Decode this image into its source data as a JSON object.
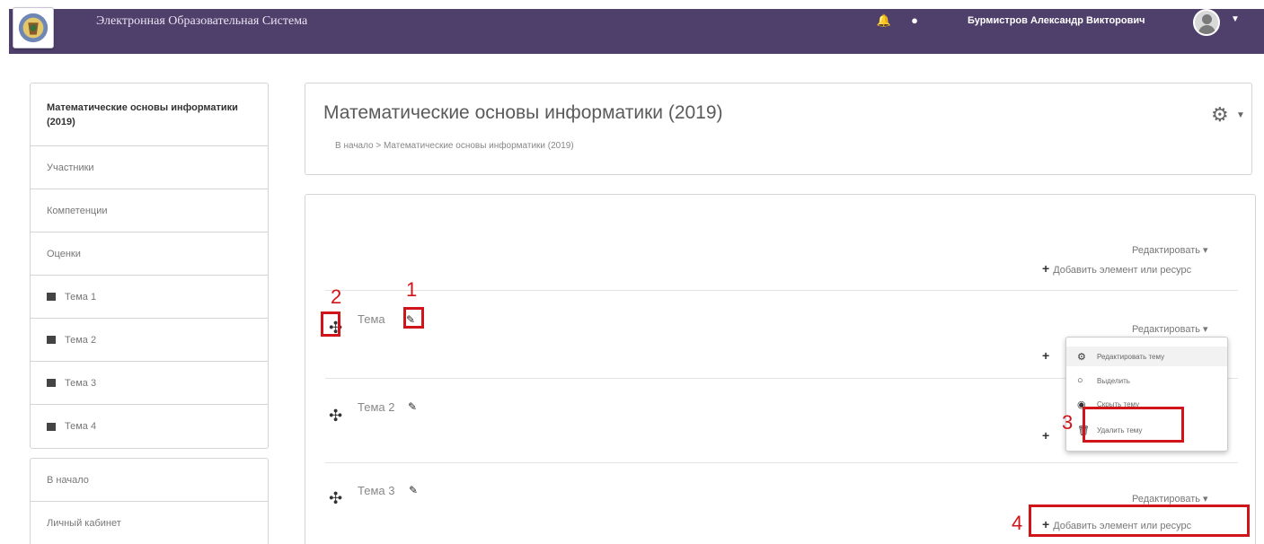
{
  "header": {
    "site_name": "Электронная Образовательная Система",
    "user_name": "Бурмистров Александр Викторович",
    "icons": [
      "bell-icon",
      "chat-icon",
      "avatar-icon",
      "caret-down-icon"
    ]
  },
  "sidebar": {
    "course": "Математические основы информатики (2019)",
    "items": [
      "Участники",
      "Компетенции",
      "Оценки",
      "Тема 1",
      "Тема 2",
      "Тема 3",
      "Тема 4"
    ],
    "nav": [
      "В начало",
      "Личный кабинет"
    ]
  },
  "course_header": {
    "title": "Математические основы информатики (2019)",
    "breadcrumb": "В начало  >  Математические основы информатики (2019)"
  },
  "content": {
    "edit_label": "Редактировать",
    "add_label": "Добавить элемент или ресурс",
    "sections": [
      {
        "title": "Тема"
      },
      {
        "title": "Тема 2"
      },
      {
        "title": "Тема 3"
      }
    ],
    "menu": [
      "Редактировать тему",
      "Выделить",
      "Скрыть тему",
      "Удалить тему"
    ]
  },
  "annotations": [
    "1",
    "2",
    "3",
    "4"
  ],
  "colors": {
    "topbar": "#4e3f6b",
    "highlight": "#d0141a"
  }
}
